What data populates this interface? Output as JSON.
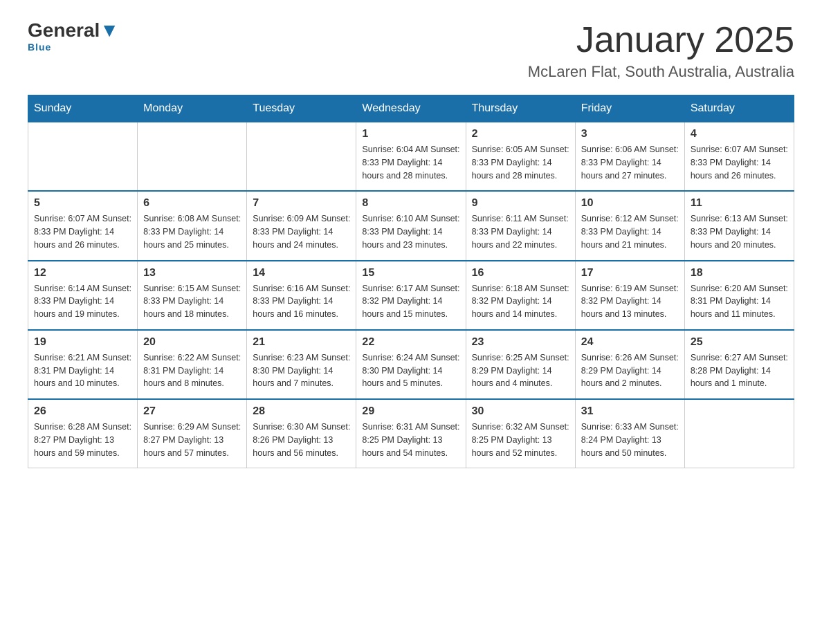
{
  "logo": {
    "general": "General",
    "blue": "Blue"
  },
  "title": "January 2025",
  "location": "McLaren Flat, South Australia, Australia",
  "weekdays": [
    "Sunday",
    "Monday",
    "Tuesday",
    "Wednesday",
    "Thursday",
    "Friday",
    "Saturday"
  ],
  "weeks": [
    [
      {
        "day": "",
        "info": ""
      },
      {
        "day": "",
        "info": ""
      },
      {
        "day": "",
        "info": ""
      },
      {
        "day": "1",
        "info": "Sunrise: 6:04 AM\nSunset: 8:33 PM\nDaylight: 14 hours\nand 28 minutes."
      },
      {
        "day": "2",
        "info": "Sunrise: 6:05 AM\nSunset: 8:33 PM\nDaylight: 14 hours\nand 28 minutes."
      },
      {
        "day": "3",
        "info": "Sunrise: 6:06 AM\nSunset: 8:33 PM\nDaylight: 14 hours\nand 27 minutes."
      },
      {
        "day": "4",
        "info": "Sunrise: 6:07 AM\nSunset: 8:33 PM\nDaylight: 14 hours\nand 26 minutes."
      }
    ],
    [
      {
        "day": "5",
        "info": "Sunrise: 6:07 AM\nSunset: 8:33 PM\nDaylight: 14 hours\nand 26 minutes."
      },
      {
        "day": "6",
        "info": "Sunrise: 6:08 AM\nSunset: 8:33 PM\nDaylight: 14 hours\nand 25 minutes."
      },
      {
        "day": "7",
        "info": "Sunrise: 6:09 AM\nSunset: 8:33 PM\nDaylight: 14 hours\nand 24 minutes."
      },
      {
        "day": "8",
        "info": "Sunrise: 6:10 AM\nSunset: 8:33 PM\nDaylight: 14 hours\nand 23 minutes."
      },
      {
        "day": "9",
        "info": "Sunrise: 6:11 AM\nSunset: 8:33 PM\nDaylight: 14 hours\nand 22 minutes."
      },
      {
        "day": "10",
        "info": "Sunrise: 6:12 AM\nSunset: 8:33 PM\nDaylight: 14 hours\nand 21 minutes."
      },
      {
        "day": "11",
        "info": "Sunrise: 6:13 AM\nSunset: 8:33 PM\nDaylight: 14 hours\nand 20 minutes."
      }
    ],
    [
      {
        "day": "12",
        "info": "Sunrise: 6:14 AM\nSunset: 8:33 PM\nDaylight: 14 hours\nand 19 minutes."
      },
      {
        "day": "13",
        "info": "Sunrise: 6:15 AM\nSunset: 8:33 PM\nDaylight: 14 hours\nand 18 minutes."
      },
      {
        "day": "14",
        "info": "Sunrise: 6:16 AM\nSunset: 8:33 PM\nDaylight: 14 hours\nand 16 minutes."
      },
      {
        "day": "15",
        "info": "Sunrise: 6:17 AM\nSunset: 8:32 PM\nDaylight: 14 hours\nand 15 minutes."
      },
      {
        "day": "16",
        "info": "Sunrise: 6:18 AM\nSunset: 8:32 PM\nDaylight: 14 hours\nand 14 minutes."
      },
      {
        "day": "17",
        "info": "Sunrise: 6:19 AM\nSunset: 8:32 PM\nDaylight: 14 hours\nand 13 minutes."
      },
      {
        "day": "18",
        "info": "Sunrise: 6:20 AM\nSunset: 8:31 PM\nDaylight: 14 hours\nand 11 minutes."
      }
    ],
    [
      {
        "day": "19",
        "info": "Sunrise: 6:21 AM\nSunset: 8:31 PM\nDaylight: 14 hours\nand 10 minutes."
      },
      {
        "day": "20",
        "info": "Sunrise: 6:22 AM\nSunset: 8:31 PM\nDaylight: 14 hours\nand 8 minutes."
      },
      {
        "day": "21",
        "info": "Sunrise: 6:23 AM\nSunset: 8:30 PM\nDaylight: 14 hours\nand 7 minutes."
      },
      {
        "day": "22",
        "info": "Sunrise: 6:24 AM\nSunset: 8:30 PM\nDaylight: 14 hours\nand 5 minutes."
      },
      {
        "day": "23",
        "info": "Sunrise: 6:25 AM\nSunset: 8:29 PM\nDaylight: 14 hours\nand 4 minutes."
      },
      {
        "day": "24",
        "info": "Sunrise: 6:26 AM\nSunset: 8:29 PM\nDaylight: 14 hours\nand 2 minutes."
      },
      {
        "day": "25",
        "info": "Sunrise: 6:27 AM\nSunset: 8:28 PM\nDaylight: 14 hours\nand 1 minute."
      }
    ],
    [
      {
        "day": "26",
        "info": "Sunrise: 6:28 AM\nSunset: 8:27 PM\nDaylight: 13 hours\nand 59 minutes."
      },
      {
        "day": "27",
        "info": "Sunrise: 6:29 AM\nSunset: 8:27 PM\nDaylight: 13 hours\nand 57 minutes."
      },
      {
        "day": "28",
        "info": "Sunrise: 6:30 AM\nSunset: 8:26 PM\nDaylight: 13 hours\nand 56 minutes."
      },
      {
        "day": "29",
        "info": "Sunrise: 6:31 AM\nSunset: 8:25 PM\nDaylight: 13 hours\nand 54 minutes."
      },
      {
        "day": "30",
        "info": "Sunrise: 6:32 AM\nSunset: 8:25 PM\nDaylight: 13 hours\nand 52 minutes."
      },
      {
        "day": "31",
        "info": "Sunrise: 6:33 AM\nSunset: 8:24 PM\nDaylight: 13 hours\nand 50 minutes."
      },
      {
        "day": "",
        "info": ""
      }
    ]
  ]
}
